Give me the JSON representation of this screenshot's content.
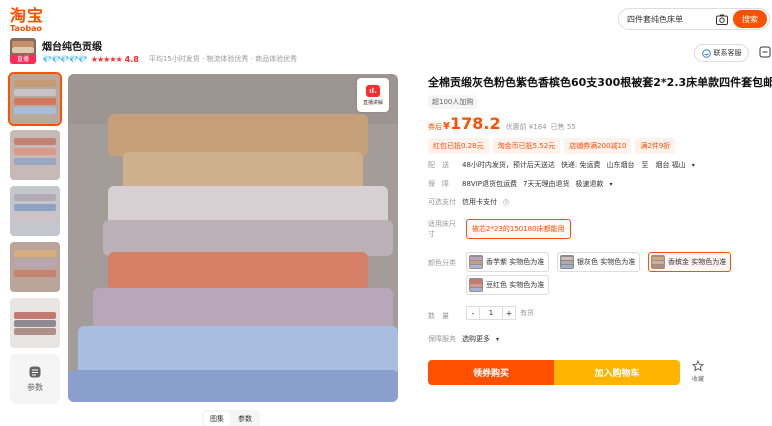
{
  "header": {
    "logo_cn": "淘宝",
    "logo_en": "Taobao",
    "search_value": "四件套纯色床单",
    "search_button": "搜索"
  },
  "shop": {
    "name": "烟台纯色贡缎",
    "live_tag": "直播",
    "diamonds": "💎💎💎💎💎",
    "stars": "★★★★★",
    "rating": "4.8",
    "tags": "平均15小时发货 · 物流体验优秀 · 商品体验优秀",
    "service_label": "联系客服"
  },
  "gallery": {
    "thumbnails_count": 5,
    "params_label": "参数",
    "live_label": "直播讲解",
    "tabs": [
      "图集",
      "参数"
    ]
  },
  "product": {
    "title": "全棉贡缎灰色粉色紫色香槟色60支300根被套2*2.3床单款四件套包邮",
    "sold_tag": "超100人加购",
    "price_label": "券后",
    "price_symbol": "¥",
    "price": "178.2",
    "orig_price": "优惠前 ¥184",
    "sold": "已售 55",
    "coupons": [
      "红包已抵0.28元",
      "淘金币已抵5.52元",
      "店铺券满200减10",
      "满2件9折"
    ],
    "delivery": {
      "label": "配　送",
      "time": "48小时内发货，预计后天送达",
      "free": "快递: 免运费",
      "route": "山东烟台　至　烟台 福山"
    },
    "guarantee": {
      "label": "保　障",
      "items": [
        "88VIP退货包运费",
        "7天无理由退货",
        "极速退款"
      ]
    },
    "payment": {
      "label": "可选支付",
      "value": "信用卡支付"
    },
    "size": {
      "label": "适用床尺寸",
      "option": "被芯2*23的150180床都能用"
    },
    "color": {
      "label": "颜色分类",
      "options": [
        "香芋紫 实物色为准",
        "银灰色 实物色为准",
        "香槟金 实物色为准",
        "豆红色 实物色为准"
      ]
    },
    "quantity": {
      "label": "数　量",
      "value": "1",
      "stock": "有货"
    },
    "service": {
      "label": "保障服务",
      "value": "选购更多"
    },
    "buy_now": "领券购买",
    "add_cart": "加入购物车",
    "favorite": "收藏"
  },
  "colors": {
    "accent": "#ff5000",
    "cart": "#ffb400",
    "green": "#00a32a"
  }
}
